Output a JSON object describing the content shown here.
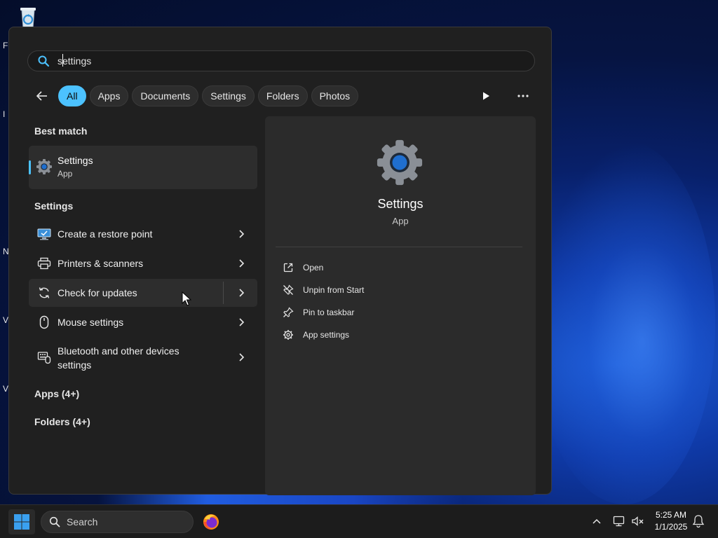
{
  "desktop": {
    "edge_letters": [
      "F",
      "I",
      "N",
      "V",
      "V"
    ]
  },
  "search": {
    "value": "settings"
  },
  "filters": {
    "tabs": [
      "All",
      "Apps",
      "Documents",
      "Settings",
      "Folders",
      "Photos"
    ],
    "active": "All"
  },
  "results": {
    "best_match_heading": "Best match",
    "best_match": {
      "title": "Settings",
      "subtitle": "App"
    },
    "settings_heading": "Settings",
    "settings_items": [
      {
        "label": "Create a restore point",
        "icon": "restore-point-icon"
      },
      {
        "label": "Printers & scanners",
        "icon": "printer-icon"
      },
      {
        "label": "Check for updates",
        "icon": "refresh-icon"
      },
      {
        "label": "Mouse settings",
        "icon": "mouse-icon"
      },
      {
        "label": "Bluetooth and other devices settings",
        "icon": "bluetooth-devices-icon"
      }
    ],
    "apps_heading": "Apps (4+)",
    "folders_heading": "Folders (4+)"
  },
  "detail": {
    "title": "Settings",
    "subtitle": "App",
    "actions": [
      {
        "label": "Open",
        "icon": "open-external-icon"
      },
      {
        "label": "Unpin from Start",
        "icon": "unpin-icon"
      },
      {
        "label": "Pin to taskbar",
        "icon": "pin-icon"
      },
      {
        "label": "App settings",
        "icon": "gear-icon"
      }
    ]
  },
  "taskbar": {
    "search_placeholder": "Search",
    "time": "5:25 AM",
    "date": "1/1/2025"
  },
  "colors": {
    "accent": "#4cc2ff",
    "panel": "#202020",
    "taskbar": "#1c1c1c"
  }
}
